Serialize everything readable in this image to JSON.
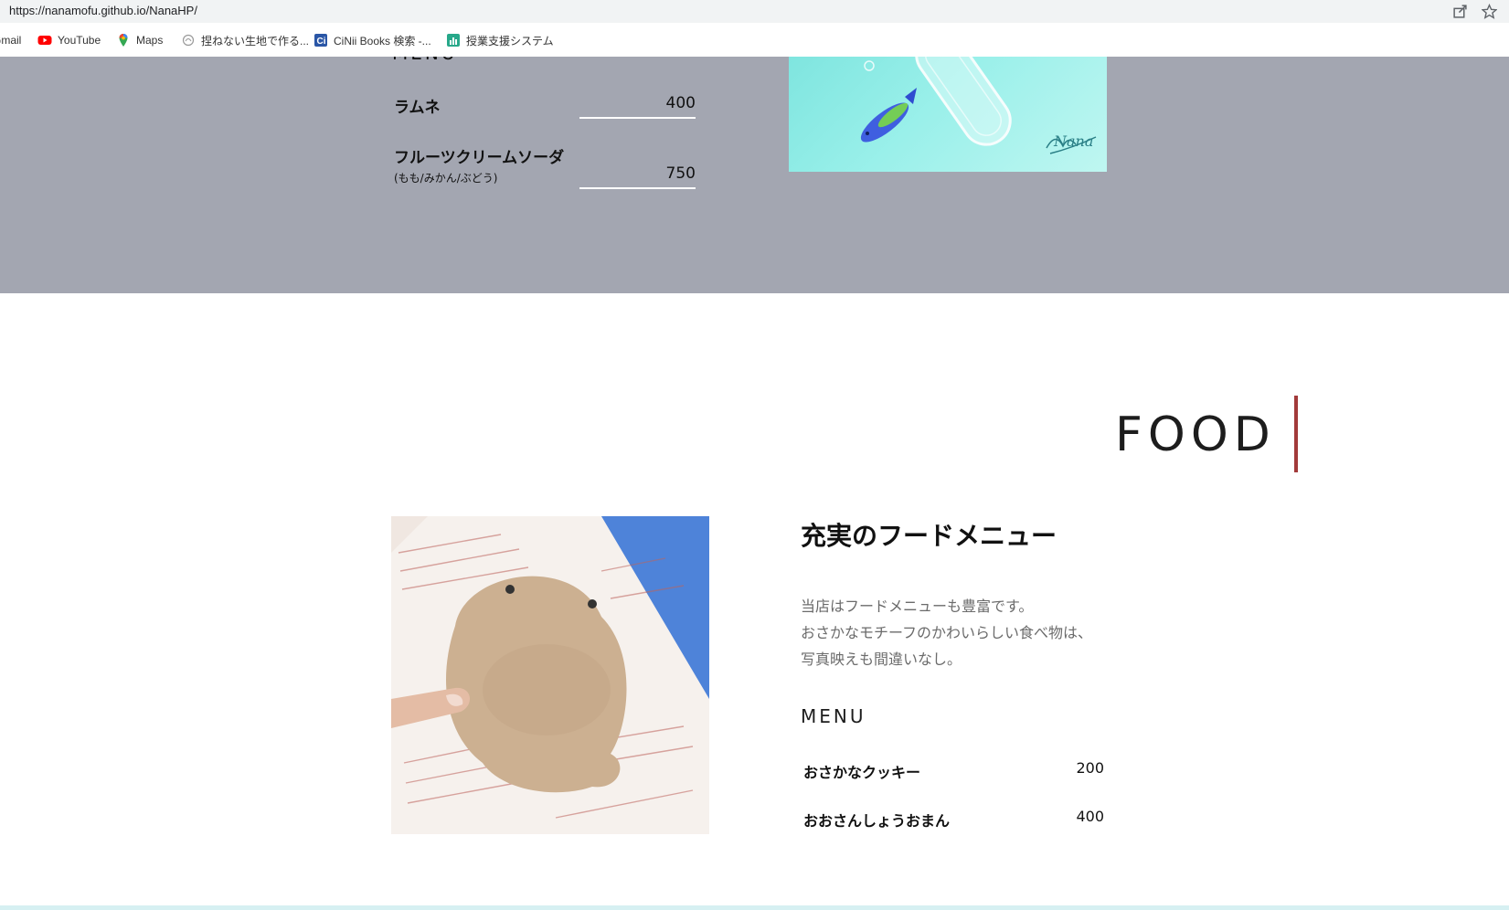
{
  "browser": {
    "url": "https://nanamofu.github.io/NanaHP/",
    "bookmarks": [
      {
        "label": "Gmail",
        "icon": "gmail-icon"
      },
      {
        "label": "YouTube",
        "icon": "youtube-icon"
      },
      {
        "label": "Maps",
        "icon": "maps-pin-icon"
      },
      {
        "label": "捏ねない生地で作る...",
        "icon": "site-icon"
      },
      {
        "label": "CiNii Books 検索 -...",
        "icon": "cinii-icon"
      },
      {
        "label": "授業支援システム",
        "icon": "class-support-icon"
      }
    ]
  },
  "drink": {
    "menu_heading": "MENU",
    "items": [
      {
        "name": "ラムネ",
        "sub": "",
        "price": "400"
      },
      {
        "name": "フルーツクリームソーダ",
        "sub": "(もも/みかん/ぶどう)",
        "price": "750"
      }
    ],
    "image_signature": "Nana"
  },
  "food": {
    "title": "FOOD",
    "heading": "充実のフードメニュー",
    "description": [
      "当店はフードメニューも豊富です。",
      "おさかなモチーフのかわいらしい食べ物は、",
      "写真映えも間違いなし。"
    ],
    "menu_heading": "MENU",
    "items": [
      {
        "name": "おさかなクッキー",
        "price": "200"
      },
      {
        "name": "おおさんしょうおまん",
        "price": "400"
      }
    ]
  },
  "colors": {
    "drink_bg": "#a3a6b1",
    "accent_bar": "#a23a3a",
    "desc_text": "#6b6b6b"
  }
}
